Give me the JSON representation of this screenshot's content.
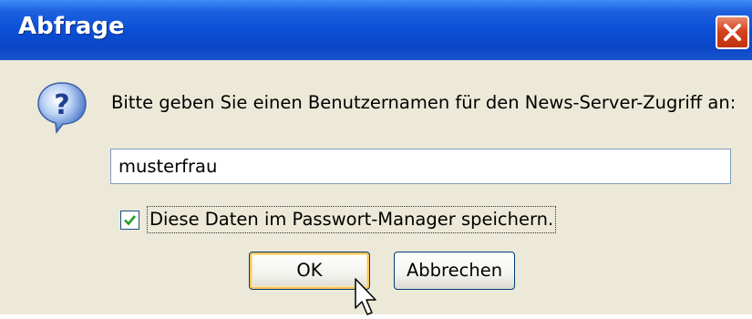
{
  "window": {
    "title": "Abfrage"
  },
  "dialog": {
    "prompt": "Bitte geben Sie einen Benutzernamen für den News-Server-Zugriff an:",
    "username_value": "musterfrau",
    "save_checkbox": {
      "label": "Diese Daten im Passwort-Manager speichern.",
      "checked": true
    },
    "ok_label": "OK",
    "cancel_label": "Abbrechen"
  },
  "icons": {
    "dialog_icon": "question-icon",
    "close": "close-icon",
    "cursor": "mouse-pointer-icon"
  },
  "colors": {
    "titlebar": "#0a4fd6",
    "close_button": "#d4421f",
    "dialog_background": "#ece9d8",
    "checkbox_check": "#21a121"
  }
}
